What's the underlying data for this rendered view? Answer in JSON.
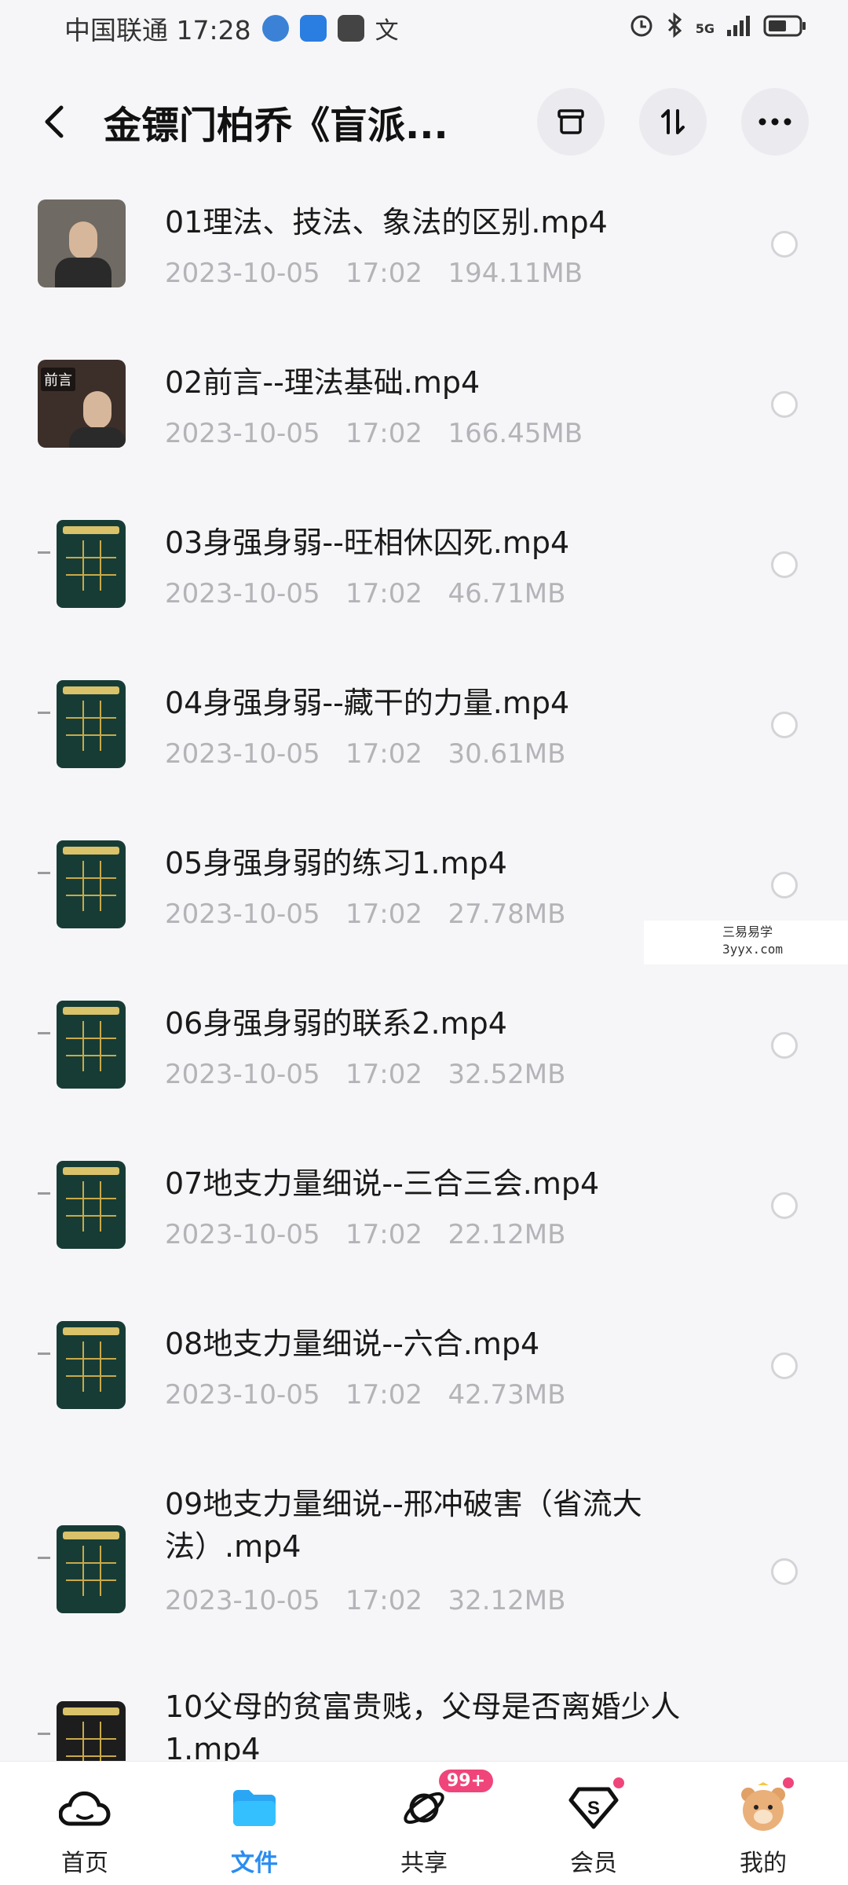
{
  "status_bar": {
    "carrier_time": "中国联通 17:28",
    "notif_char": "文",
    "network": "5G"
  },
  "header": {
    "title": "金镖门柏乔《盲派...",
    "back_icon": "chevron-left-icon",
    "actions": [
      "archive-icon",
      "sort-icon",
      "more-icon"
    ]
  },
  "files": [
    {
      "name": "01理法、技法、象法的区别.mp4",
      "date": "2023-10-05",
      "time": "17:02",
      "size": "194.11MB",
      "thumb": "photo"
    },
    {
      "name": "02前言--理法基础.mp4",
      "date": "2023-10-05",
      "time": "17:02",
      "size": "166.45MB",
      "thumb": "photo",
      "tag": "前言"
    },
    {
      "name": "03身强身弱--旺相休囚死.mp4",
      "date": "2023-10-05",
      "time": "17:02",
      "size": "46.71MB",
      "thumb": "doc"
    },
    {
      "name": "04身强身弱--藏干的力量.mp4",
      "date": "2023-10-05",
      "time": "17:02",
      "size": "30.61MB",
      "thumb": "doc"
    },
    {
      "name": "05身强身弱的练习1.mp4",
      "date": "2023-10-05",
      "time": "17:02",
      "size": "27.78MB",
      "thumb": "doc"
    },
    {
      "name": "06身强身弱的联系2.mp4",
      "date": "2023-10-05",
      "time": "17:02",
      "size": "32.52MB",
      "thumb": "doc"
    },
    {
      "name": "07地支力量细说--三合三会.mp4",
      "date": "2023-10-05",
      "time": "17:02",
      "size": "22.12MB",
      "thumb": "doc"
    },
    {
      "name": "08地支力量细说--六合.mp4",
      "date": "2023-10-05",
      "time": "17:02",
      "size": "42.73MB",
      "thumb": "doc"
    },
    {
      "name": "09地支力量细说--邢冲破害（省流大法）.mp4",
      "date": "2023-10-05",
      "time": "17:02",
      "size": "32.12MB",
      "thumb": "doc"
    },
    {
      "name": "10父母的贫富贵贱，父母是否离婚少人1.mp4",
      "date": "",
      "time": "",
      "size": "",
      "thumb": "doc"
    }
  ],
  "watermark": {
    "line1": "三易易学",
    "line2": "3yyx.com"
  },
  "tabs": [
    {
      "label": "首页",
      "icon": "cloud-home-icon",
      "active": false
    },
    {
      "label": "文件",
      "icon": "folder-icon",
      "active": true
    },
    {
      "label": "共享",
      "icon": "share-orbit-icon",
      "active": false,
      "badge": "99+"
    },
    {
      "label": "会员",
      "icon": "vip-diamond-icon",
      "active": false,
      "dot": true
    },
    {
      "label": "我的",
      "icon": "avatar-bear-icon",
      "active": false,
      "dot": true
    }
  ]
}
